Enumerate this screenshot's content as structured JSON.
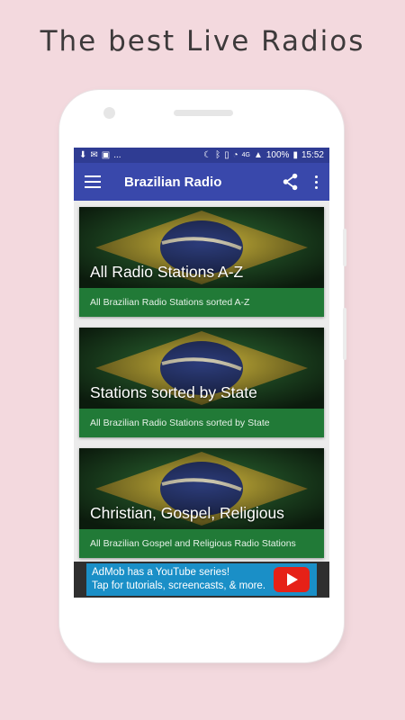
{
  "promo": {
    "title": "The best Live Radios"
  },
  "statusbar": {
    "left_more": "...",
    "battery": "100%",
    "time": "15:52",
    "network": "4G"
  },
  "appbar": {
    "title": "Brazilian Radio",
    "icons": [
      "menu-icon",
      "share-icon",
      "more-vert-icon"
    ]
  },
  "cards": [
    {
      "title": "All Radio Stations A-Z",
      "subtitle": "All Brazilian Radio Stations sorted A-Z"
    },
    {
      "title": "Stations sorted by State",
      "subtitle": "All Brazilian Radio Stations sorted by State"
    },
    {
      "title": "Christian, Gospel, Religious",
      "subtitle": "All Brazilian Gospel and Religious Radio Stations"
    }
  ],
  "ad": {
    "line1": "AdMob has a YouTube series!",
    "line2": "Tap for tutorials, screencasts, & more."
  },
  "colors": {
    "statusbar": "#2f3c93",
    "appbar": "#3948ab",
    "card_footer": "#217a37",
    "ad": "#1a8fc7",
    "background": "#f3d9de"
  }
}
